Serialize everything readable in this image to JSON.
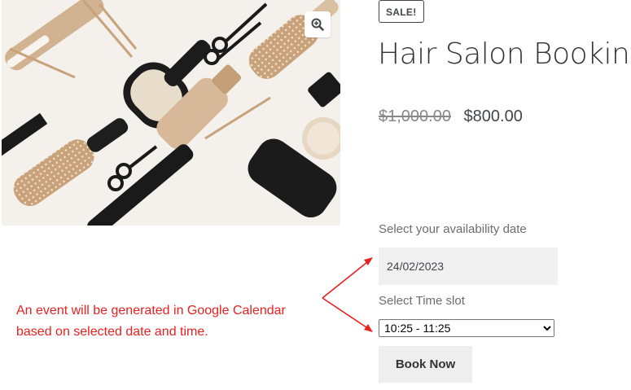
{
  "product": {
    "sale_badge": "SALE!",
    "title": "Hair Salon Booking",
    "price_old": "$1,000.00",
    "price_new": "$800.00",
    "image_description": "hair-tools-photo"
  },
  "form": {
    "date_label": "Select your availability date",
    "date_value": "24/02/2023",
    "time_label": "Select Time slot",
    "time_selected": "10:25 - 11:25",
    "submit_label": "Book Now"
  },
  "annotation": {
    "line1": "An event will be generated in Google Calendar",
    "line2": "based on selected date and time."
  },
  "icons": {
    "zoom": "zoom-in-icon"
  },
  "colors": {
    "annotation_red": "#e8211f",
    "button_bg": "#eeeeee",
    "input_bg": "#f0f0f0",
    "text_dark": "#43454b"
  }
}
